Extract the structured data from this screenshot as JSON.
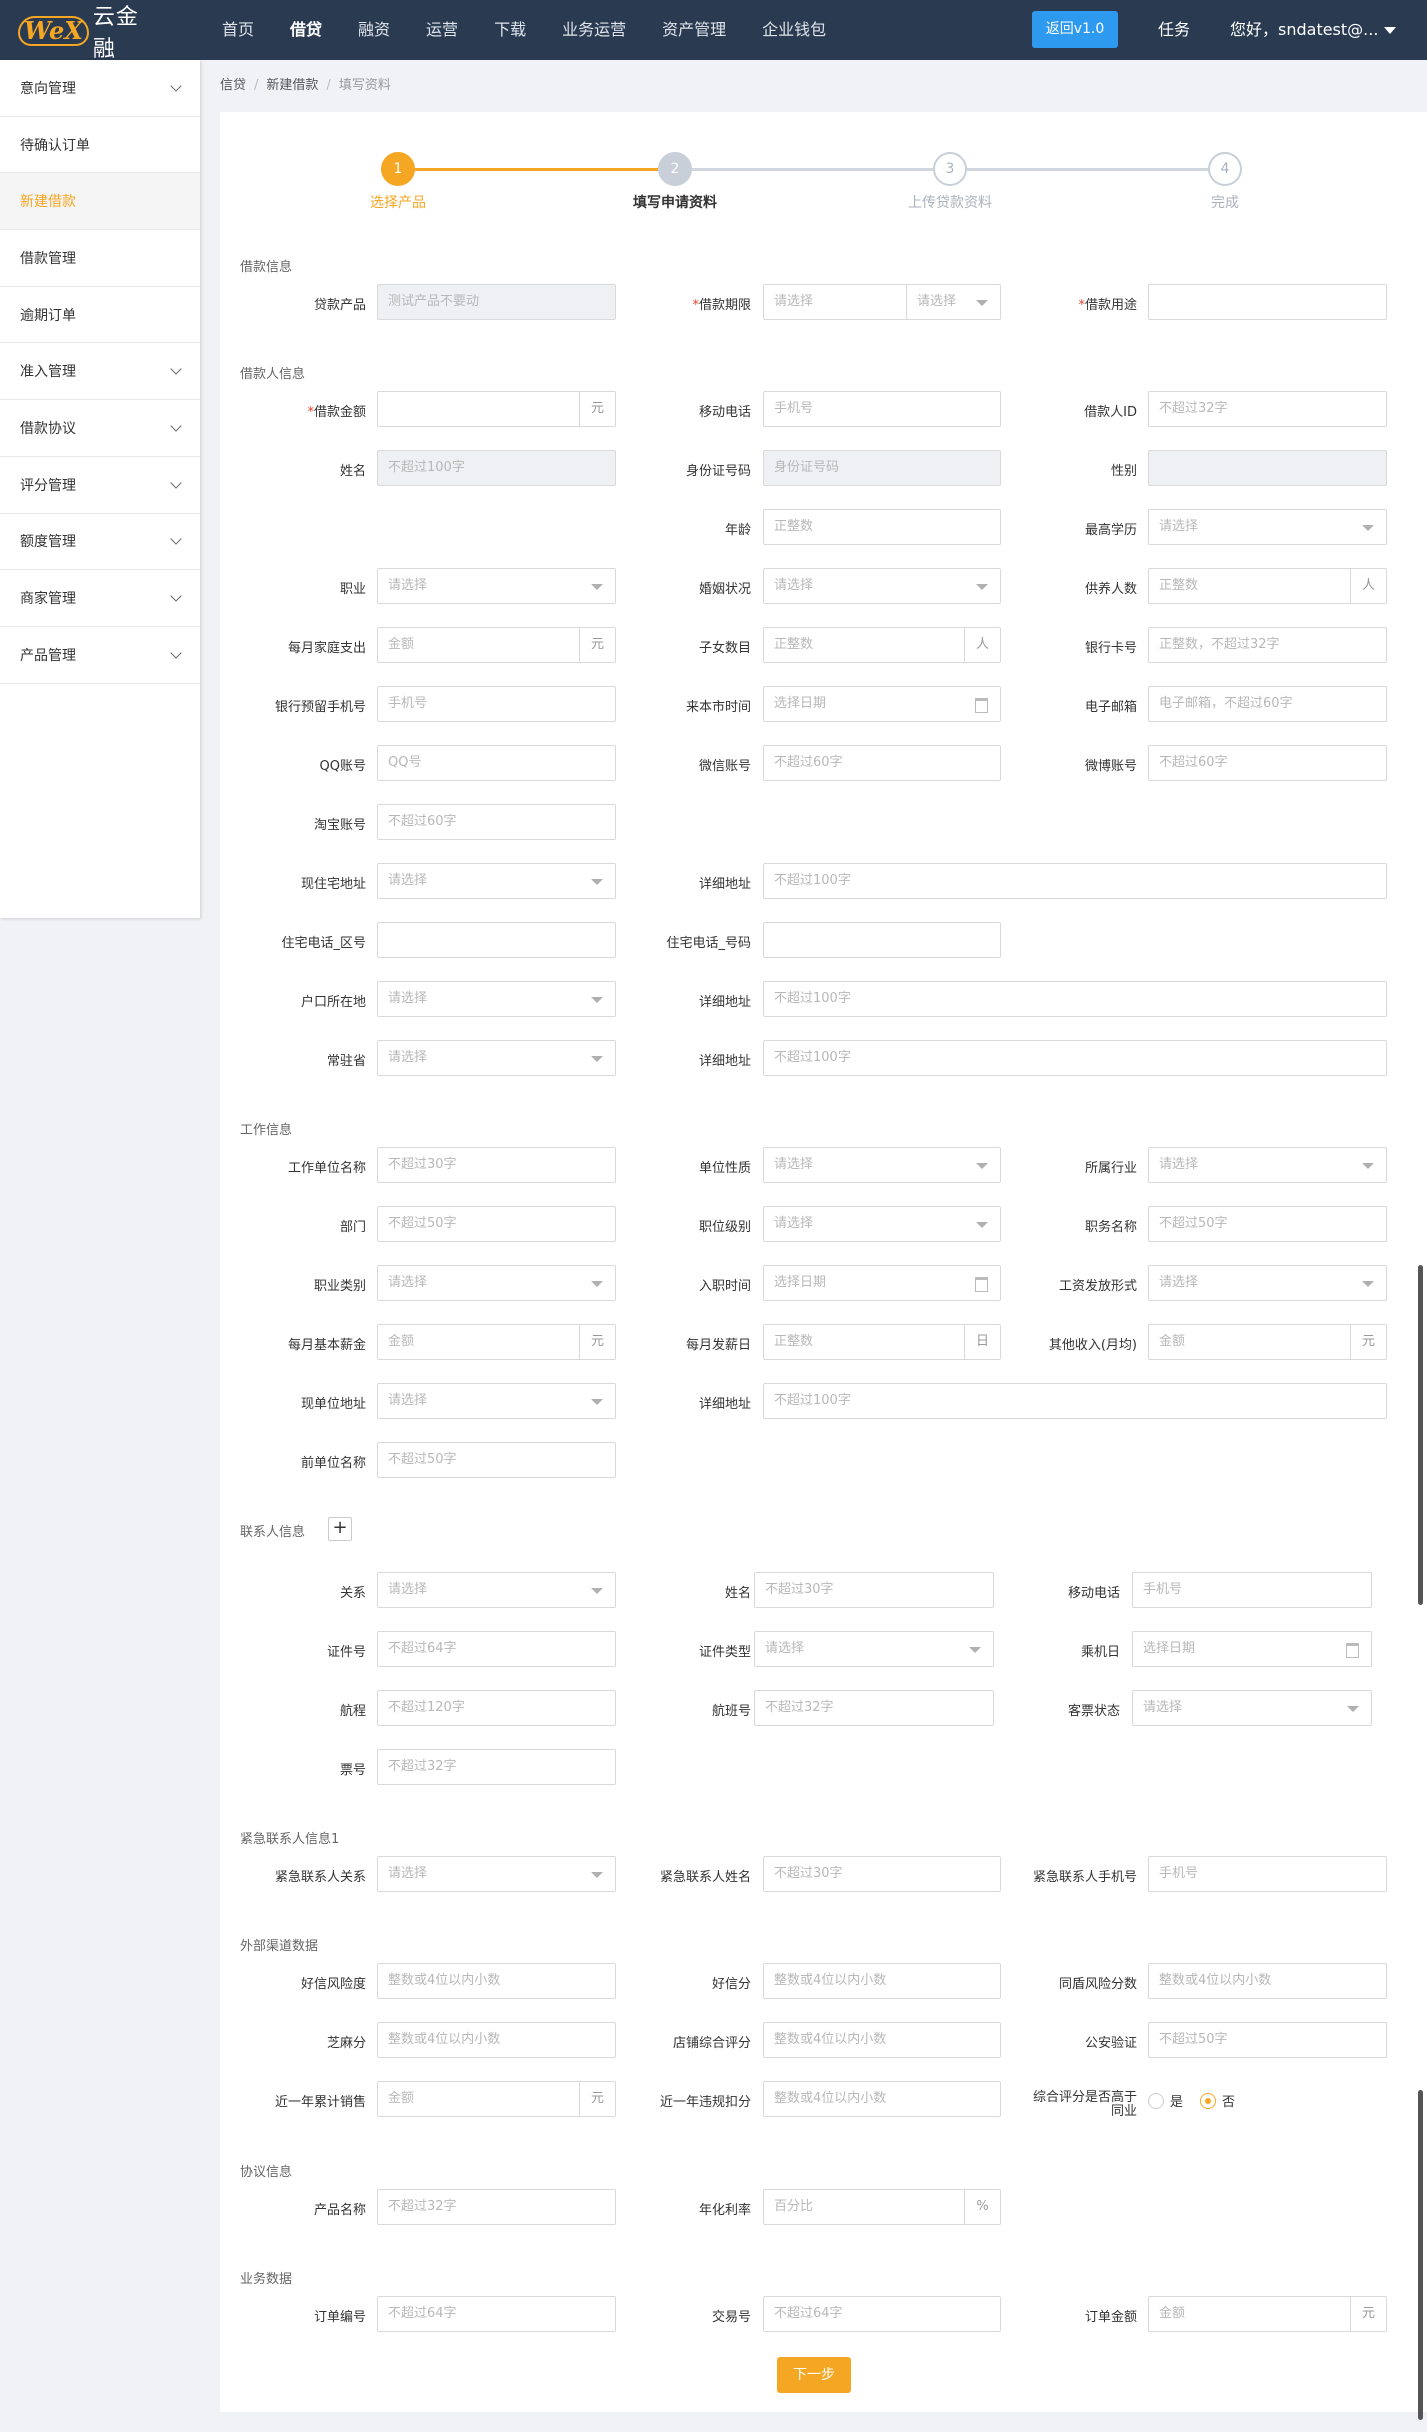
{
  "topbar": {
    "logo_mark": "WeX",
    "logo_text": "云金融",
    "nav": [
      "首页",
      "借贷",
      "融资",
      "运营",
      "下载",
      "业务运营",
      "资产管理",
      "企业钱包"
    ],
    "active_nav": "借贷",
    "return_btn": "返回v1.0",
    "tasks": "任务",
    "user": "您好，sndatest@..."
  },
  "sidebar": {
    "items": [
      {
        "label": "意向管理",
        "expand": true
      },
      {
        "label": "待确认订单",
        "expand": false
      },
      {
        "label": "新建借款",
        "expand": false,
        "active": true
      },
      {
        "label": "借款管理",
        "expand": false
      },
      {
        "label": "逾期订单",
        "expand": false
      },
      {
        "label": "准入管理",
        "expand": true
      },
      {
        "label": "借款协议",
        "expand": true
      },
      {
        "label": "评分管理",
        "expand": true
      },
      {
        "label": "额度管理",
        "expand": true
      },
      {
        "label": "商家管理",
        "expand": true
      },
      {
        "label": "产品管理",
        "expand": true
      }
    ]
  },
  "breadcrumb": [
    "信贷",
    "新建借款",
    "填写资料"
  ],
  "steps": [
    {
      "num": "1",
      "label": "选择产品",
      "state": "done"
    },
    {
      "num": "2",
      "label": "填写申请资料",
      "state": "current"
    },
    {
      "num": "3",
      "label": "上传贷款资料",
      "state": "todo"
    },
    {
      "num": "4",
      "label": "完成",
      "state": "todo"
    }
  ],
  "sections": {
    "loan": "借款信息",
    "borrower": "借款人信息",
    "work": "工作信息",
    "contact": "联系人信息",
    "emergency": "紧急联系人信息1",
    "external": "外部渠道数据",
    "agreement": "协议信息",
    "business": "业务数据"
  },
  "fields": {
    "loan_product": {
      "label": "贷款产品",
      "value": "测试产品不要动"
    },
    "loan_term": {
      "label": "借款期限",
      "placeholder": "请选择"
    },
    "loan_use": {
      "label": "借款用途"
    },
    "loan_amount": {
      "label": "借款金额",
      "suffix": "元"
    },
    "mobile": {
      "label": "移动电话",
      "placeholder": "手机号"
    },
    "borrower_id": {
      "label": "借款人ID",
      "placeholder": "不超过32字"
    },
    "name": {
      "label": "姓名",
      "placeholder": "不超过100字"
    },
    "id_number": {
      "label": "身份证号码",
      "placeholder": "身份证号码"
    },
    "gender": {
      "label": "性别"
    },
    "age": {
      "label": "年龄",
      "placeholder": "正整数"
    },
    "education": {
      "label": "最高学历",
      "placeholder": "请选择"
    },
    "occupation": {
      "label": "职业",
      "placeholder": "请选择"
    },
    "marital": {
      "label": "婚姻状况",
      "placeholder": "请选择"
    },
    "dependents": {
      "label": "供养人数",
      "placeholder": "正整数",
      "suffix": "人"
    },
    "family_expense": {
      "label": "每月家庭支出",
      "placeholder": "金额",
      "suffix": "元"
    },
    "children": {
      "label": "子女数目",
      "placeholder": "正整数",
      "suffix": "人"
    },
    "bank_card": {
      "label": "银行卡号",
      "placeholder": "正整数，不超过32字"
    },
    "bank_phone": {
      "label": "银行预留手机号",
      "placeholder": "手机号"
    },
    "arrival_time": {
      "label": "来本市时间",
      "placeholder": "选择日期"
    },
    "email": {
      "label": "电子邮箱",
      "placeholder": "电子邮箱，不超过60字"
    },
    "qq": {
      "label": "QQ账号",
      "placeholder": "QQ号"
    },
    "wechat": {
      "label": "微信账号",
      "placeholder": "不超过60字"
    },
    "weibo": {
      "label": "微博账号",
      "placeholder": "不超过60字"
    },
    "taobao": {
      "label": "淘宝账号",
      "placeholder": "不超过60字"
    },
    "home_addr": {
      "label": "现住宅地址",
      "placeholder": "请选择"
    },
    "home_detail": {
      "label": "详细地址",
      "placeholder": "不超过100字"
    },
    "home_area": {
      "label": "住宅电话_区号"
    },
    "home_phone": {
      "label": "住宅电话_号码"
    },
    "hukou": {
      "label": "户口所在地",
      "placeholder": "请选择"
    },
    "hukou_detail": {
      "label": "详细地址",
      "placeholder": "不超过100字"
    },
    "province": {
      "label": "常驻省",
      "placeholder": "请选择"
    },
    "province_detail": {
      "label": "详细地址",
      "placeholder": "不超过100字"
    },
    "company": {
      "label": "工作单位名称",
      "placeholder": "不超过30字"
    },
    "company_type": {
      "label": "单位性质",
      "placeholder": "请选择"
    },
    "industry": {
      "label": "所属行业",
      "placeholder": "请选择"
    },
    "department": {
      "label": "部门",
      "placeholder": "不超过50字"
    },
    "position_level": {
      "label": "职位级别",
      "placeholder": "请选择"
    },
    "job_title": {
      "label": "职务名称",
      "placeholder": "不超过50字"
    },
    "job_category": {
      "label": "职业类别",
      "placeholder": "请选择"
    },
    "entry_date": {
      "label": "入职时间",
      "placeholder": "选择日期"
    },
    "salary_form": {
      "label": "工资发放形式",
      "placeholder": "请选择"
    },
    "salary": {
      "label": "每月基本薪金",
      "placeholder": "金额",
      "suffix": "元"
    },
    "payday": {
      "label": "每月发薪日",
      "placeholder": "正整数",
      "suffix": "日"
    },
    "other_income": {
      "label": "其他收入(月均)",
      "placeholder": "金额",
      "suffix": "元"
    },
    "work_addr": {
      "label": "现单位地址",
      "placeholder": "请选择"
    },
    "work_detail": {
      "label": "详细地址",
      "placeholder": "不超过100字"
    },
    "prev_company": {
      "label": "前单位名称",
      "placeholder": "不超过50字"
    },
    "relation": {
      "label": "关系",
      "placeholder": "请选择"
    },
    "contact_name": {
      "label": "姓名",
      "placeholder": "不超过30字"
    },
    "contact_mobile": {
      "label": "移动电话",
      "placeholder": "手机号"
    },
    "cert_no": {
      "label": "证件号",
      "placeholder": "不超过64字"
    },
    "cert_type": {
      "label": "证件类型",
      "placeholder": "请选择"
    },
    "flight_date": {
      "label": "乘机日",
      "placeholder": "选择日期"
    },
    "route": {
      "label": "航程",
      "placeholder": "不超过120字"
    },
    "flight_no": {
      "label": "航班号",
      "placeholder": "不超过32字"
    },
    "ticket_status": {
      "label": "客票状态",
      "placeholder": "请选择"
    },
    "ticket_no": {
      "label": "票号",
      "placeholder": "不超过32字"
    },
    "emg_relation": {
      "label": "紧急联系人关系",
      "placeholder": "请选择"
    },
    "emg_name": {
      "label": "紧急联系人姓名",
      "placeholder": "不超过30字"
    },
    "emg_phone": {
      "label": "紧急联系人手机号",
      "placeholder": "手机号"
    },
    "hx_risk": {
      "label": "好信风险度",
      "placeholder": "整数或4位以内小数"
    },
    "hx_score": {
      "label": "好信分",
      "placeholder": "整数或4位以内小数"
    },
    "td_risk": {
      "label": "同盾风险分数",
      "placeholder": "整数或4位以内小数"
    },
    "sesame": {
      "label": "芝麻分",
      "placeholder": "整数或4位以内小数"
    },
    "shop_score": {
      "label": "店铺综合评分",
      "placeholder": "整数或4位以内小数"
    },
    "police": {
      "label": "公安验证",
      "placeholder": "不超过50字"
    },
    "year_sales": {
      "label": "近一年累计销售",
      "placeholder": "金额",
      "suffix": "元"
    },
    "year_deduct": {
      "label": "近一年违规扣分",
      "placeholder": "整数或4位以内小数"
    },
    "above_industry": {
      "label_1": "综合评分是否高于",
      "label_2": "同业",
      "yes": "是",
      "no": "否",
      "selected": "否"
    },
    "product_name": {
      "label": "产品名称",
      "placeholder": "不超过32字"
    },
    "annual_rate": {
      "label": "年化利率",
      "placeholder": "百分比",
      "suffix": "%"
    },
    "order_no": {
      "label": "订单编号",
      "placeholder": "不超过64字"
    },
    "trade_no": {
      "label": "交易号",
      "placeholder": "不超过64字"
    },
    "order_amount": {
      "label": "订单金额",
      "placeholder": "金额",
      "suffix": "元"
    }
  },
  "next_button": "下一步",
  "colors": {
    "accent": "#f5a623",
    "topbar": "#2a3a51",
    "primary_btn": "#2d9af0",
    "required": "#e8412c"
  }
}
